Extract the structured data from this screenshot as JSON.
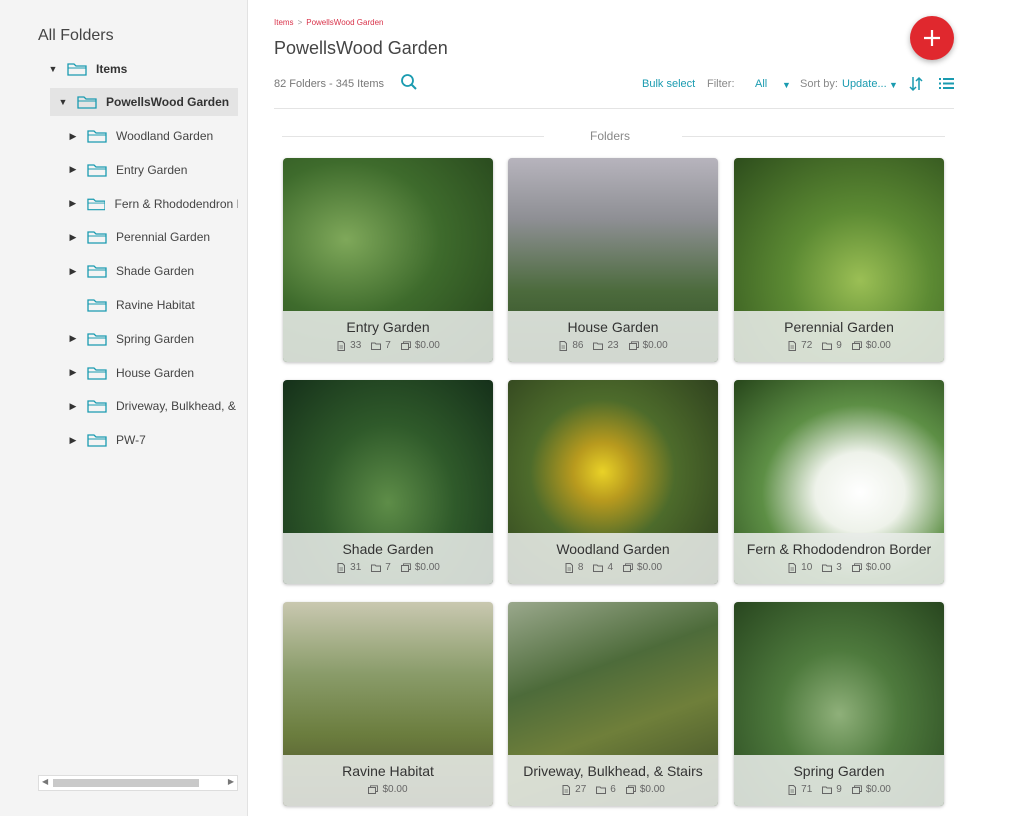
{
  "sidebar": {
    "title": "All Folders",
    "root": "Items",
    "current": "PowellsWood Garden",
    "children": [
      {
        "label": "Woodland Garden",
        "expandable": true
      },
      {
        "label": "Entry Garden",
        "expandable": true
      },
      {
        "label": "Fern & Rhododendron B",
        "expandable": true
      },
      {
        "label": "Perennial Garden",
        "expandable": true
      },
      {
        "label": "Shade Garden",
        "expandable": true
      },
      {
        "label": "Ravine Habitat",
        "expandable": false
      },
      {
        "label": "Spring Garden",
        "expandable": true
      },
      {
        "label": "House Garden",
        "expandable": true
      },
      {
        "label": "Driveway, Bulkhead, &",
        "expandable": true
      },
      {
        "label": "PW-7",
        "expandable": true
      }
    ]
  },
  "breadcrumb": {
    "root": "Items",
    "sep": ">",
    "current": "PowellsWood Garden"
  },
  "page_title": "PowellsWood Garden",
  "counts": "82 Folders - 345 Items",
  "toolbar": {
    "bulk_select": "Bulk select",
    "filter_label": "Filter:",
    "filter_value": "All",
    "sort_label": "Sort by:",
    "sort_value": "Update..."
  },
  "section_label": "Folders",
  "colors": {
    "accent": "#1a9bb0",
    "fab": "#e0282e",
    "breadcrumb": "#d9344b"
  },
  "cards": [
    {
      "name": "Entry Garden",
      "items": "33",
      "folders": "7",
      "value": "$0.00"
    },
    {
      "name": "House Garden",
      "items": "86",
      "folders": "23",
      "value": "$0.00"
    },
    {
      "name": "Perennial Garden",
      "items": "72",
      "folders": "9",
      "value": "$0.00"
    },
    {
      "name": "Shade Garden",
      "items": "31",
      "folders": "7",
      "value": "$0.00"
    },
    {
      "name": "Woodland Garden",
      "items": "8",
      "folders": "4",
      "value": "$0.00"
    },
    {
      "name": "Fern & Rhododendron Border",
      "items": "10",
      "folders": "3",
      "value": "$0.00"
    },
    {
      "name": "Ravine Habitat",
      "items": null,
      "folders": null,
      "value": "$0.00"
    },
    {
      "name": "Driveway, Bulkhead, & Stairs",
      "items": "27",
      "folders": "6",
      "value": "$0.00"
    },
    {
      "name": "Spring Garden",
      "items": "71",
      "folders": "9",
      "value": "$0.00"
    }
  ]
}
